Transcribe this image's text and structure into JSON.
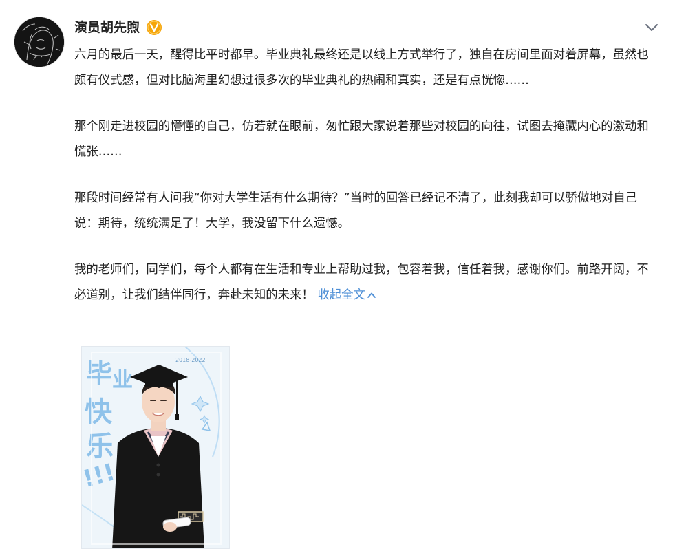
{
  "post": {
    "author": "演员胡先煦",
    "paragraphs": [
      "六月的最后一天，醒得比平时都早。毕业典礼最终还是以线上方式举行了，独自在房间里面对着屏幕，虽然也颇有仪式感，但对比脑海里幻想过很多次的毕业典礼的热闹和真实，还是有点恍惚……",
      "那个刚走进校园的懵懂的自己，仿若就在眼前，匆忙跟大家说着那些对校园的向往，试图去掩藏内心的激动和慌张……",
      "那段时间经常有人问我“你对大学生活有什么期待？”当时的回答已经记不清了，此刻我却可以骄傲地对自己说：期待，统统满足了！大学，我没留下什么遗憾。",
      "我的老师们，同学们，每个人都有在生活和专业上帮助过我，包容着我，信任着我，感谢你们。前路开阔，不必道别，让我们结伴同行，奔赴未知的未来！"
    ],
    "collapse_label": "收起全文",
    "photo": {
      "date_label": "2018-2022",
      "handwriting": [
        "毕",
        "业",
        "快",
        "乐",
        "!!!"
      ]
    }
  },
  "icons": {
    "verified": "verified-badge-icon",
    "menu": "chevron-down-icon",
    "collapse": "chevron-up-icon"
  },
  "colors": {
    "link": "#4e8fd6",
    "verified_badge": "#f5a50a",
    "text": "#222222",
    "handwriting": "#8fc2ea"
  }
}
